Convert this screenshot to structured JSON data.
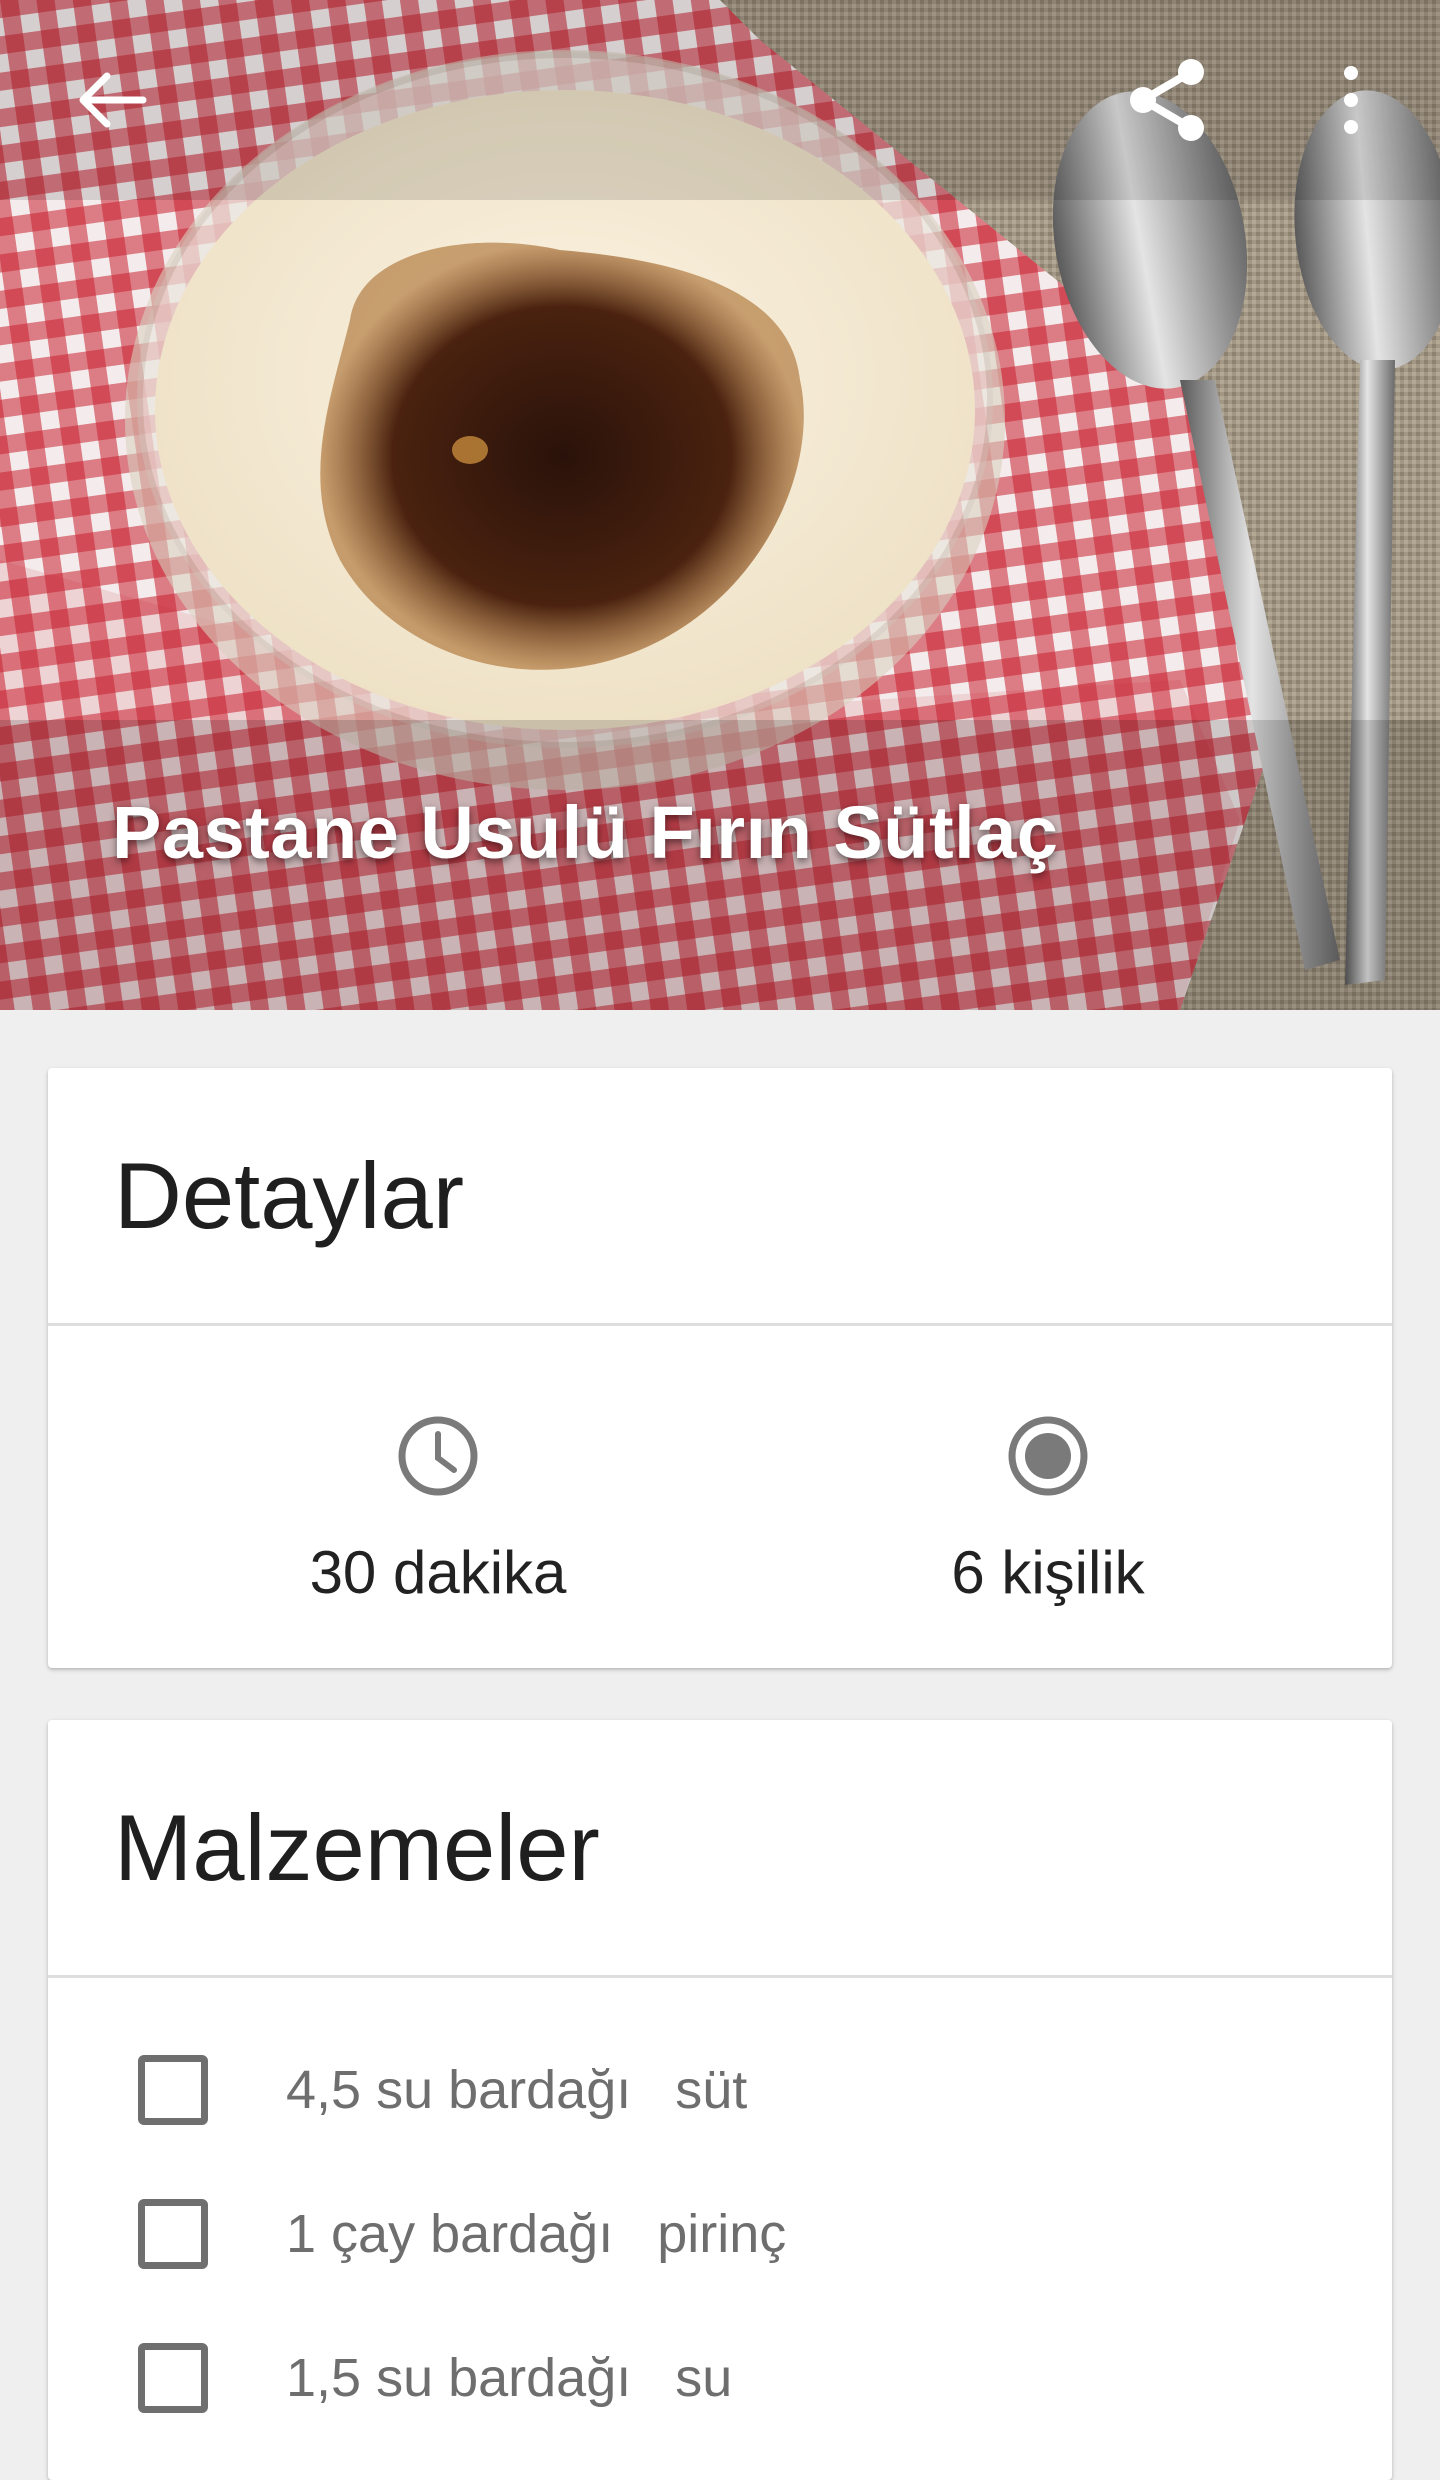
{
  "toolbar": {
    "back_icon": "arrow-left-icon",
    "share_icon": "share-icon",
    "more_icon": "more-vertical-icon",
    "icon_color": "#ffffff"
  },
  "hero": {
    "title": "Pastane Usulü Fırın Sütlaç",
    "image_subject": "rice pudding in glass bowl on red gingham napkin with spoons"
  },
  "details": {
    "title": "Detaylar",
    "time_icon": "clock-icon",
    "time_label": "30 dakika",
    "serving_icon": "radio-filled-icon",
    "serving_label": "6 kişilik"
  },
  "ingredients": {
    "title": "Malzemeler",
    "items": [
      {
        "amount": "4,5 su bardağı",
        "name": "süt",
        "checked": false
      },
      {
        "amount": "1 çay bardağı",
        "name": "pirinç",
        "checked": false
      },
      {
        "amount": "1,5 su bardağı",
        "name": "su",
        "checked": false
      }
    ]
  }
}
